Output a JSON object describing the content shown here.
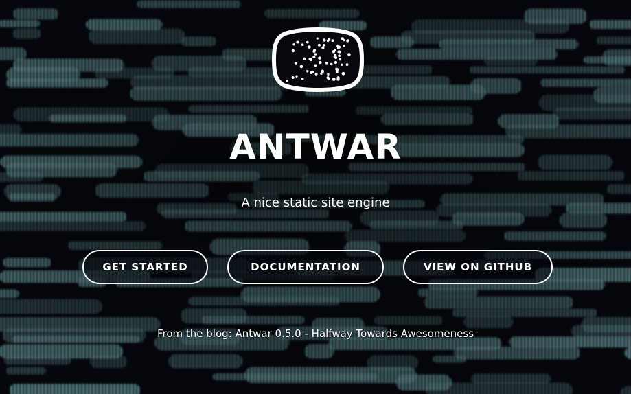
{
  "hero": {
    "title": "ANTWAR",
    "tagline": "A nice static site engine"
  },
  "buttons": {
    "get_started": "GET STARTED",
    "documentation": "DOCUMENTATION",
    "github": "VIEW ON GITHUB"
  },
  "blog": {
    "prefix": "From the blog: ",
    "post": "Antwar 0.5.0 - Halfway Towards Awesomeness"
  },
  "icons": {
    "logo": "ant-swarm-logo-icon"
  },
  "colors": {
    "background": "#05070c",
    "text": "#ffffff",
    "glitch_teal": "#3aa99a",
    "glitch_magenta": "#b03a7a"
  }
}
